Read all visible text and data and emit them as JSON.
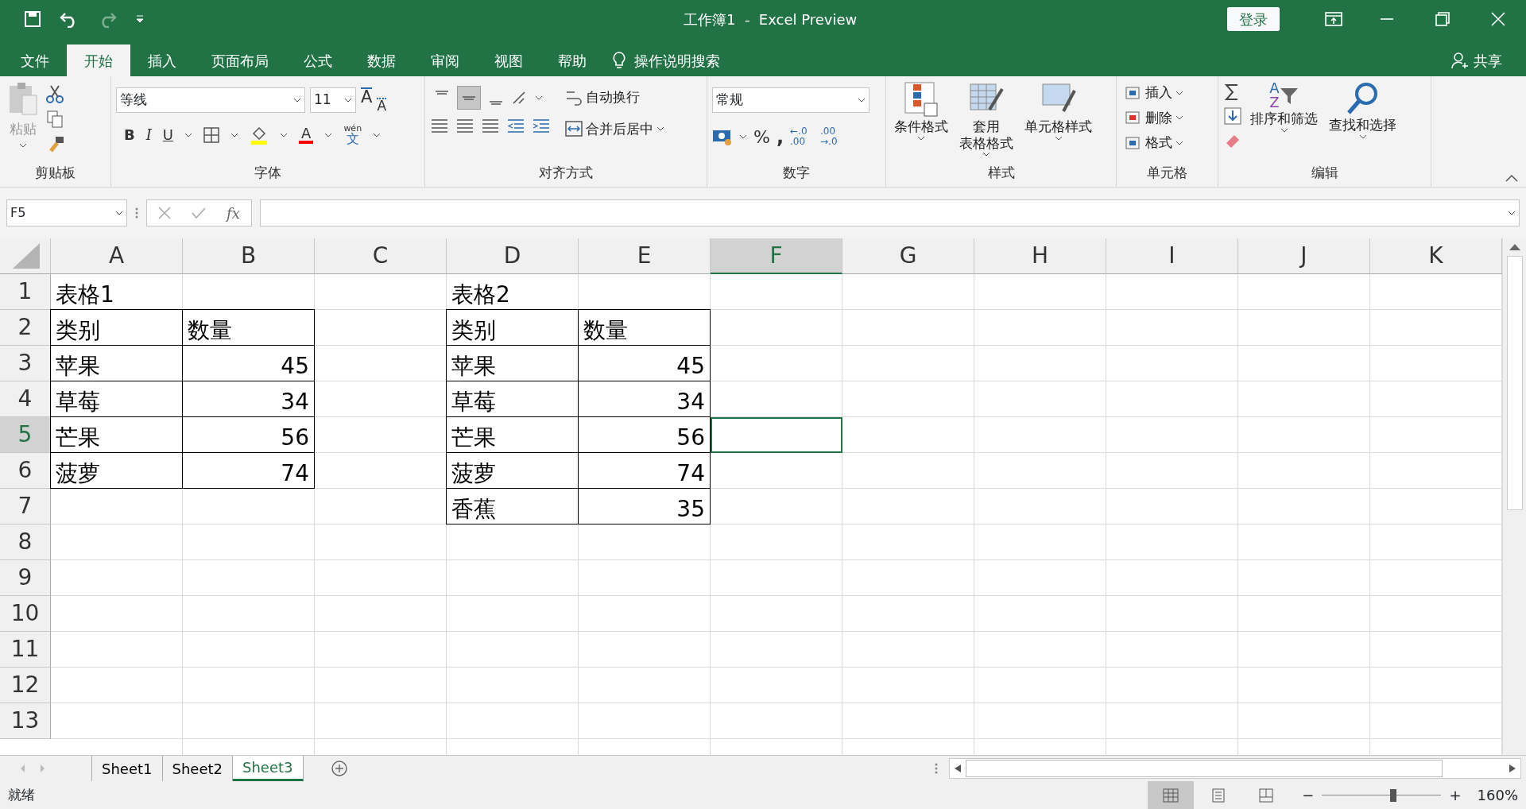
{
  "window": {
    "title": "工作簿1  -  Excel Preview",
    "login_button": "登录"
  },
  "tabs": [
    {
      "label": "文件",
      "selected": false
    },
    {
      "label": "开始",
      "selected": true
    },
    {
      "label": "插入",
      "selected": false
    },
    {
      "label": "页面布局",
      "selected": false
    },
    {
      "label": "公式",
      "selected": false
    },
    {
      "label": "数据",
      "selected": false
    },
    {
      "label": "审阅",
      "selected": false
    },
    {
      "label": "视图",
      "selected": false
    },
    {
      "label": "帮助",
      "selected": false
    }
  ],
  "tell_me": "操作说明搜索",
  "share": "共享",
  "ribbon": {
    "clipboard": {
      "label": "剪贴板",
      "paste": "粘贴"
    },
    "font": {
      "label": "字体",
      "font_name": "等线",
      "font_size": "11",
      "grow": "A",
      "shrink": "A",
      "bold": "B",
      "italic": "I",
      "underline": "U",
      "font_color": "A",
      "phonetic": "wén",
      "phonetic_char": "文"
    },
    "alignment": {
      "label": "对齐方式",
      "vertical": [
        {
          "kind": "top",
          "selected": false
        },
        {
          "kind": "middle",
          "selected": true
        },
        {
          "kind": "bottom",
          "selected": false
        }
      ],
      "wrap": "自动换行",
      "merge": "合并后居中"
    },
    "number": {
      "label": "数字",
      "format": "常规",
      "percent": "%",
      "comma": ",",
      "increase_decimal": "←.0 .00",
      "decrease_decimal": ".00 →.0"
    },
    "styles": {
      "label": "样式",
      "conditional": "条件格式",
      "table_line1": "套用",
      "table_line2": "表格格式",
      "cell_styles": "单元格样式"
    },
    "cells": {
      "label": "单元格",
      "items": [
        {
          "kind": "insert",
          "label": "插入"
        },
        {
          "kind": "delete",
          "label": "删除"
        },
        {
          "kind": "format",
          "label": "格式"
        }
      ]
    },
    "editing": {
      "label": "编辑",
      "sort_letters": [
        "A",
        "Z"
      ],
      "sort": "排序和筛选",
      "find": "查找和选择"
    }
  },
  "name_box": "F5",
  "formula_fx": "fx",
  "sheet": {
    "columns": [
      {
        "label": "A",
        "selected": false
      },
      {
        "label": "B",
        "selected": false
      },
      {
        "label": "C",
        "selected": false
      },
      {
        "label": "D",
        "selected": false
      },
      {
        "label": "E",
        "selected": false
      },
      {
        "label": "F",
        "selected": true
      },
      {
        "label": "G",
        "selected": false
      },
      {
        "label": "H",
        "selected": false
      },
      {
        "label": "I",
        "selected": false
      },
      {
        "label": "J",
        "selected": false
      },
      {
        "label": "K",
        "selected": false
      }
    ],
    "rows": [
      {
        "label": "1",
        "selected": false,
        "cells": [
          {
            "text": "表格1",
            "kind": "text",
            "bordered": false
          },
          {},
          {},
          {
            "text": "表格2",
            "kind": "text",
            "bordered": false
          },
          {},
          {},
          {},
          {},
          {},
          {},
          {}
        ]
      },
      {
        "label": "2",
        "selected": false,
        "cells": [
          {
            "text": "类别",
            "kind": "text",
            "bordered": true
          },
          {
            "text": "数量",
            "kind": "text",
            "bordered": true
          },
          {},
          {
            "text": "类别",
            "kind": "text",
            "bordered": true
          },
          {
            "text": "数量",
            "kind": "text",
            "bordered": true
          },
          {},
          {},
          {},
          {},
          {},
          {}
        ]
      },
      {
        "label": "3",
        "selected": false,
        "cells": [
          {
            "text": "苹果",
            "kind": "text",
            "bordered": true
          },
          {
            "text": "45",
            "kind": "number",
            "bordered": true
          },
          {},
          {
            "text": "苹果",
            "kind": "text",
            "bordered": true
          },
          {
            "text": "45",
            "kind": "number",
            "bordered": true
          },
          {},
          {},
          {},
          {},
          {},
          {}
        ]
      },
      {
        "label": "4",
        "selected": false,
        "cells": [
          {
            "text": "草莓",
            "kind": "text",
            "bordered": true
          },
          {
            "text": "34",
            "kind": "number",
            "bordered": true
          },
          {},
          {
            "text": "草莓",
            "kind": "text",
            "bordered": true
          },
          {
            "text": "34",
            "kind": "number",
            "bordered": true
          },
          {},
          {},
          {},
          {},
          {},
          {}
        ]
      },
      {
        "label": "5",
        "selected": true,
        "cells": [
          {
            "text": "芒果",
            "kind": "text",
            "bordered": true
          },
          {
            "text": "56",
            "kind": "number",
            "bordered": true
          },
          {},
          {
            "text": "芒果",
            "kind": "text",
            "bordered": true
          },
          {
            "text": "56",
            "kind": "number",
            "bordered": true
          },
          {
            "selected": true
          },
          {},
          {},
          {},
          {},
          {}
        ]
      },
      {
        "label": "6",
        "selected": false,
        "cells": [
          {
            "text": "菠萝",
            "kind": "text",
            "bordered": true
          },
          {
            "text": "74",
            "kind": "number",
            "bordered": true
          },
          {},
          {
            "text": "菠萝",
            "kind": "text",
            "bordered": true
          },
          {
            "text": "74",
            "kind": "number",
            "bordered": true
          },
          {},
          {},
          {},
          {},
          {},
          {}
        ]
      },
      {
        "label": "7",
        "selected": false,
        "cells": [
          {},
          {},
          {},
          {
            "text": "香蕉",
            "kind": "text",
            "bordered": true
          },
          {
            "text": "35",
            "kind": "number",
            "bordered": true
          },
          {},
          {},
          {},
          {},
          {},
          {}
        ]
      },
      {
        "label": "8",
        "selected": false,
        "cells": [
          {},
          {},
          {},
          {},
          {},
          {},
          {},
          {},
          {},
          {},
          {}
        ]
      },
      {
        "label": "9",
        "selected": false,
        "cells": [
          {},
          {},
          {},
          {},
          {},
          {},
          {},
          {},
          {},
          {},
          {}
        ]
      },
      {
        "label": "10",
        "selected": false,
        "cells": [
          {},
          {},
          {},
          {},
          {},
          {},
          {},
          {},
          {},
          {},
          {}
        ]
      },
      {
        "label": "11",
        "selected": false,
        "cells": [
          {},
          {},
          {},
          {},
          {},
          {},
          {},
          {},
          {},
          {},
          {}
        ]
      },
      {
        "label": "12",
        "selected": false,
        "cells": [
          {},
          {},
          {},
          {},
          {},
          {},
          {},
          {},
          {},
          {},
          {}
        ]
      },
      {
        "label": "13",
        "selected": false,
        "cells": [
          {},
          {},
          {},
          {},
          {},
          {},
          {},
          {},
          {},
          {},
          {}
        ]
      }
    ]
  },
  "sheet_tabs": [
    {
      "label": "Sheet1",
      "selected": false
    },
    {
      "label": "Sheet2",
      "selected": false
    },
    {
      "label": "Sheet3",
      "selected": true
    }
  ],
  "status_bar": {
    "text": "就绪",
    "views": [
      {
        "kind": "normal",
        "selected": true
      },
      {
        "kind": "page_layout",
        "selected": false
      },
      {
        "kind": "page_break",
        "selected": false
      }
    ],
    "zoom_minus": "−",
    "zoom_plus": "+",
    "zoom": {
      "level": 0.6
    },
    "zoom_text": "160%"
  }
}
